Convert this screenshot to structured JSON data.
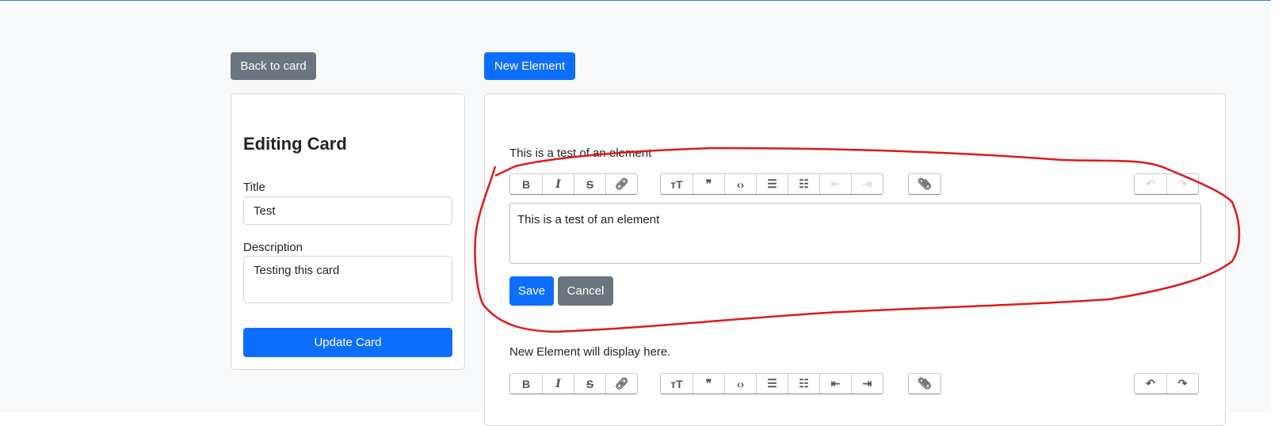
{
  "back_button": "Back to card",
  "new_element_button": "New Element",
  "edit_card": {
    "heading": "Editing Card",
    "title_label": "Title",
    "title_value": "Test",
    "description_label": "Description",
    "description_value": "Testing this card",
    "submit": "Update Card"
  },
  "elements": [
    {
      "display_text": "This is a test of an element",
      "editor_content": "This is a test of an element",
      "save": "Save",
      "cancel": "Cancel",
      "undo_enabled": false,
      "redo_enabled": false,
      "indent_enabled": false
    },
    {
      "display_text": "New Element will display here.",
      "undo_enabled": true,
      "redo_enabled": true,
      "indent_enabled": true
    }
  ],
  "toolbar": {
    "text_tools": [
      "bold-icon",
      "italic-icon",
      "strikethrough-icon",
      "link-icon"
    ],
    "block_tools": [
      "heading-icon",
      "quote-icon",
      "code-icon",
      "bullet-list-icon",
      "numbered-list-icon",
      "decrease-indent-icon",
      "increase-indent-icon"
    ],
    "file_tools": [
      "attach-icon"
    ],
    "history_tools": [
      "undo-icon",
      "redo-icon"
    ]
  },
  "annotation_color": "#e0191b"
}
